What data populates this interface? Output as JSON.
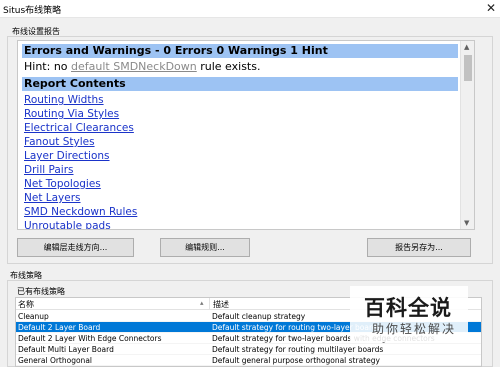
{
  "window": {
    "title": "Situs布线策略",
    "close_glyph": "✕"
  },
  "report_group": {
    "label": "布线设置报告",
    "sections": {
      "errors_header": "Errors and Warnings - 0 Errors 0 Warnings 1 Hint",
      "hint_prefix": "Hint: no ",
      "hint_link": "default SMDNeckDown",
      "hint_suffix": " rule exists.",
      "contents_header": "Report Contents"
    },
    "links": [
      "Routing Widths",
      "Routing Via Styles",
      "Electrical Clearances",
      "Fanout Styles",
      "Layer Directions",
      "Drill Pairs",
      "Net Topologies",
      "Net Layers",
      "SMD Neckdown Rules",
      "Unroutable pads"
    ],
    "buttons": {
      "edit_layer_directions": "编辑层走线方向...",
      "edit_rules": "编辑规则...",
      "save_report_as": "报告另存为..."
    }
  },
  "strategy_group": {
    "label": "布线策略",
    "available_label": "已有布线策略",
    "columns": {
      "name": "名称",
      "description": "描述"
    },
    "rows": [
      {
        "name": "Cleanup",
        "description": "Default cleanup strategy",
        "selected": false
      },
      {
        "name": "Default 2 Layer Board",
        "description": "Default strategy for routing two-layer boards",
        "selected": true
      },
      {
        "name": "Default 2 Layer With Edge Connectors",
        "description": "Default strategy for two-layer boards with edge connectors",
        "selected": false
      },
      {
        "name": "Default Multi Layer Board",
        "description": "Default strategy for routing multilayer boards",
        "selected": false
      },
      {
        "name": "General Orthogonal",
        "description": "Default general purpose orthogonal strategy",
        "selected": false
      }
    ]
  },
  "watermark": {
    "brand": "百科全说",
    "tagline": "助你轻松解决"
  },
  "colors": {
    "selection": "#0078d7",
    "report_header": "#9dc3f3",
    "link": "#1a33c9"
  }
}
